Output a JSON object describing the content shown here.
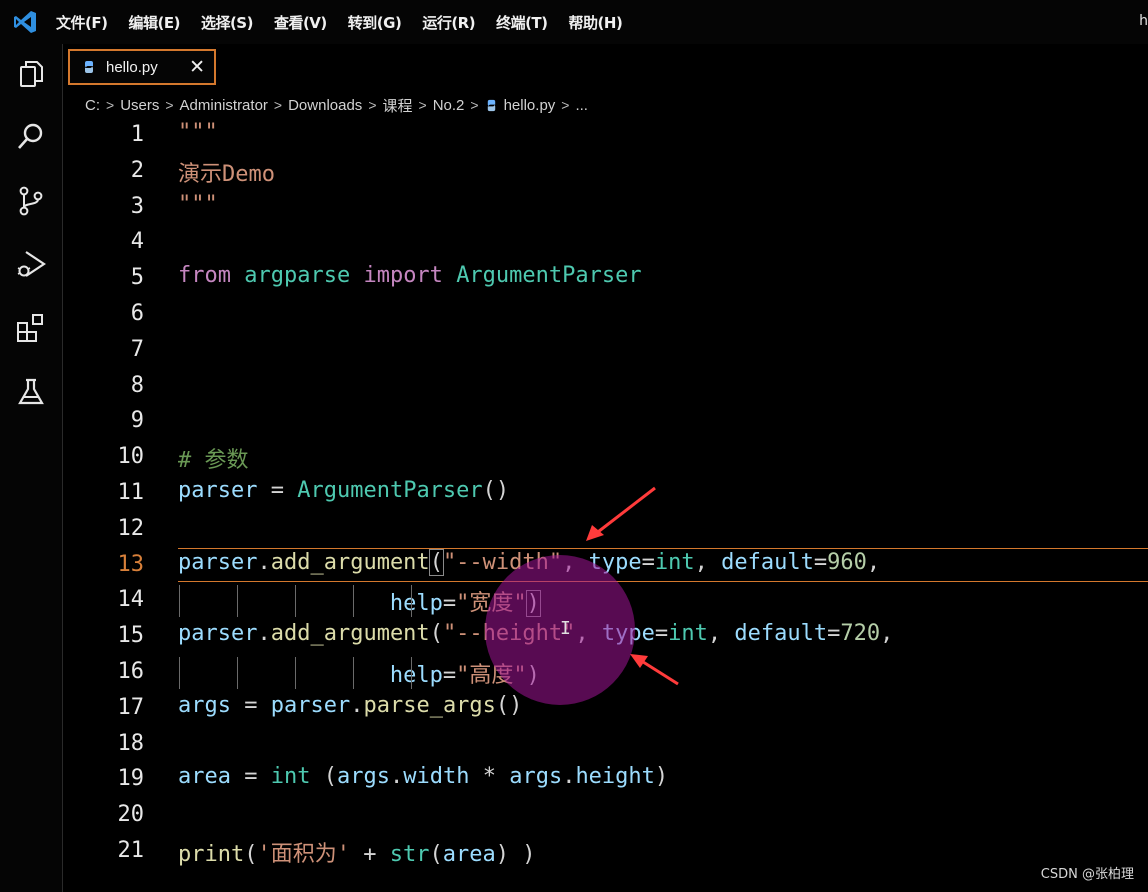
{
  "app": {
    "window_title_fragment": "h",
    "accent_color": "#d4782d"
  },
  "menu": {
    "items": [
      "文件(F)",
      "编辑(E)",
      "选择(S)",
      "查看(V)",
      "转到(G)",
      "运行(R)",
      "终端(T)",
      "帮助(H)"
    ]
  },
  "activity_bar": {
    "icons": [
      "explorer-icon",
      "search-icon",
      "source-control-icon",
      "run-debug-icon",
      "extensions-icon",
      "testing-icon"
    ]
  },
  "tab": {
    "label": "hello.py",
    "close_glyph": "✕"
  },
  "breadcrumb": {
    "items": [
      "C:",
      "Users",
      "Administrator",
      "Downloads",
      "课程",
      "No.2",
      "hello.py",
      "..."
    ]
  },
  "editor": {
    "active_line": 13,
    "line_numbers": [
      "1",
      "2",
      "3",
      "4",
      "5",
      "6",
      "7",
      "8",
      "9",
      "10",
      "11",
      "12",
      "13",
      "14",
      "15",
      "16",
      "17",
      "18",
      "19",
      "20",
      "21"
    ],
    "lines": [
      [
        [
          "str",
          "\"\"\""
        ]
      ],
      [
        [
          "str",
          "演示Demo"
        ]
      ],
      [
        [
          "str",
          "\"\"\""
        ]
      ],
      [],
      [
        [
          "kw-flow",
          "from"
        ],
        [
          "punct",
          " "
        ],
        [
          "kw-name",
          "argparse"
        ],
        [
          "punct",
          " "
        ],
        [
          "kw-flow",
          "import"
        ],
        [
          "punct",
          " "
        ],
        [
          "type",
          "ArgumentParser"
        ]
      ],
      [],
      [],
      [],
      [],
      [
        [
          "comment",
          "# 参数"
        ]
      ],
      [
        [
          "ident",
          "parser"
        ],
        [
          "punct",
          " = "
        ],
        [
          "type",
          "ArgumentParser"
        ],
        [
          "punct",
          "()"
        ]
      ],
      [],
      [
        [
          "ident",
          "parser"
        ],
        [
          "punct",
          "."
        ],
        [
          "fn",
          "add_argument"
        ],
        [
          "punct bracket-box",
          "("
        ],
        [
          "str",
          "\"--width\""
        ],
        [
          "punct",
          ", "
        ],
        [
          "ident",
          "type"
        ],
        [
          "punct",
          "="
        ],
        [
          "type",
          "int"
        ],
        [
          "punct",
          ", "
        ],
        [
          "ident",
          "default"
        ],
        [
          "punct",
          "="
        ],
        [
          "num",
          "960"
        ],
        [
          "punct",
          ","
        ]
      ],
      [
        [
          "punct",
          "                "
        ],
        [
          "ident",
          "help"
        ],
        [
          "punct",
          "="
        ],
        [
          "str",
          "\"宽度\""
        ],
        [
          "punct bracket-box",
          ")"
        ]
      ],
      [
        [
          "ident",
          "parser"
        ],
        [
          "punct",
          "."
        ],
        [
          "fn",
          "add_argument"
        ],
        [
          "punct",
          "("
        ],
        [
          "str",
          "\"--height\""
        ],
        [
          "punct",
          ", "
        ],
        [
          "ident",
          "type"
        ],
        [
          "punct",
          "="
        ],
        [
          "type",
          "int"
        ],
        [
          "punct",
          ", "
        ],
        [
          "ident",
          "default"
        ],
        [
          "punct",
          "="
        ],
        [
          "num",
          "720"
        ],
        [
          "punct",
          ","
        ]
      ],
      [
        [
          "punct",
          "                "
        ],
        [
          "ident",
          "help"
        ],
        [
          "punct",
          "="
        ],
        [
          "str",
          "\"高度\""
        ],
        [
          "punct",
          ")"
        ]
      ],
      [
        [
          "ident",
          "args"
        ],
        [
          "punct",
          " = "
        ],
        [
          "ident",
          "parser"
        ],
        [
          "punct",
          "."
        ],
        [
          "fn",
          "parse_args"
        ],
        [
          "punct",
          "()"
        ]
      ],
      [],
      [
        [
          "ident",
          "area"
        ],
        [
          "punct",
          " = "
        ],
        [
          "type",
          "int"
        ],
        [
          "punct",
          " ("
        ],
        [
          "ident",
          "args"
        ],
        [
          "punct",
          "."
        ],
        [
          "ident",
          "width"
        ],
        [
          "punct",
          " * "
        ],
        [
          "ident",
          "args"
        ],
        [
          "punct",
          "."
        ],
        [
          "ident",
          "height"
        ],
        [
          "punct",
          ")"
        ]
      ],
      [],
      [
        [
          "fn",
          "print"
        ],
        [
          "punct",
          "("
        ],
        [
          "str",
          "'面积为'"
        ],
        [
          "punct",
          " + "
        ],
        [
          "type",
          "str"
        ],
        [
          "punct",
          "("
        ],
        [
          "ident",
          "area"
        ],
        [
          "punct",
          ") )"
        ]
      ]
    ]
  },
  "watermark": "CSDN @张柏理"
}
